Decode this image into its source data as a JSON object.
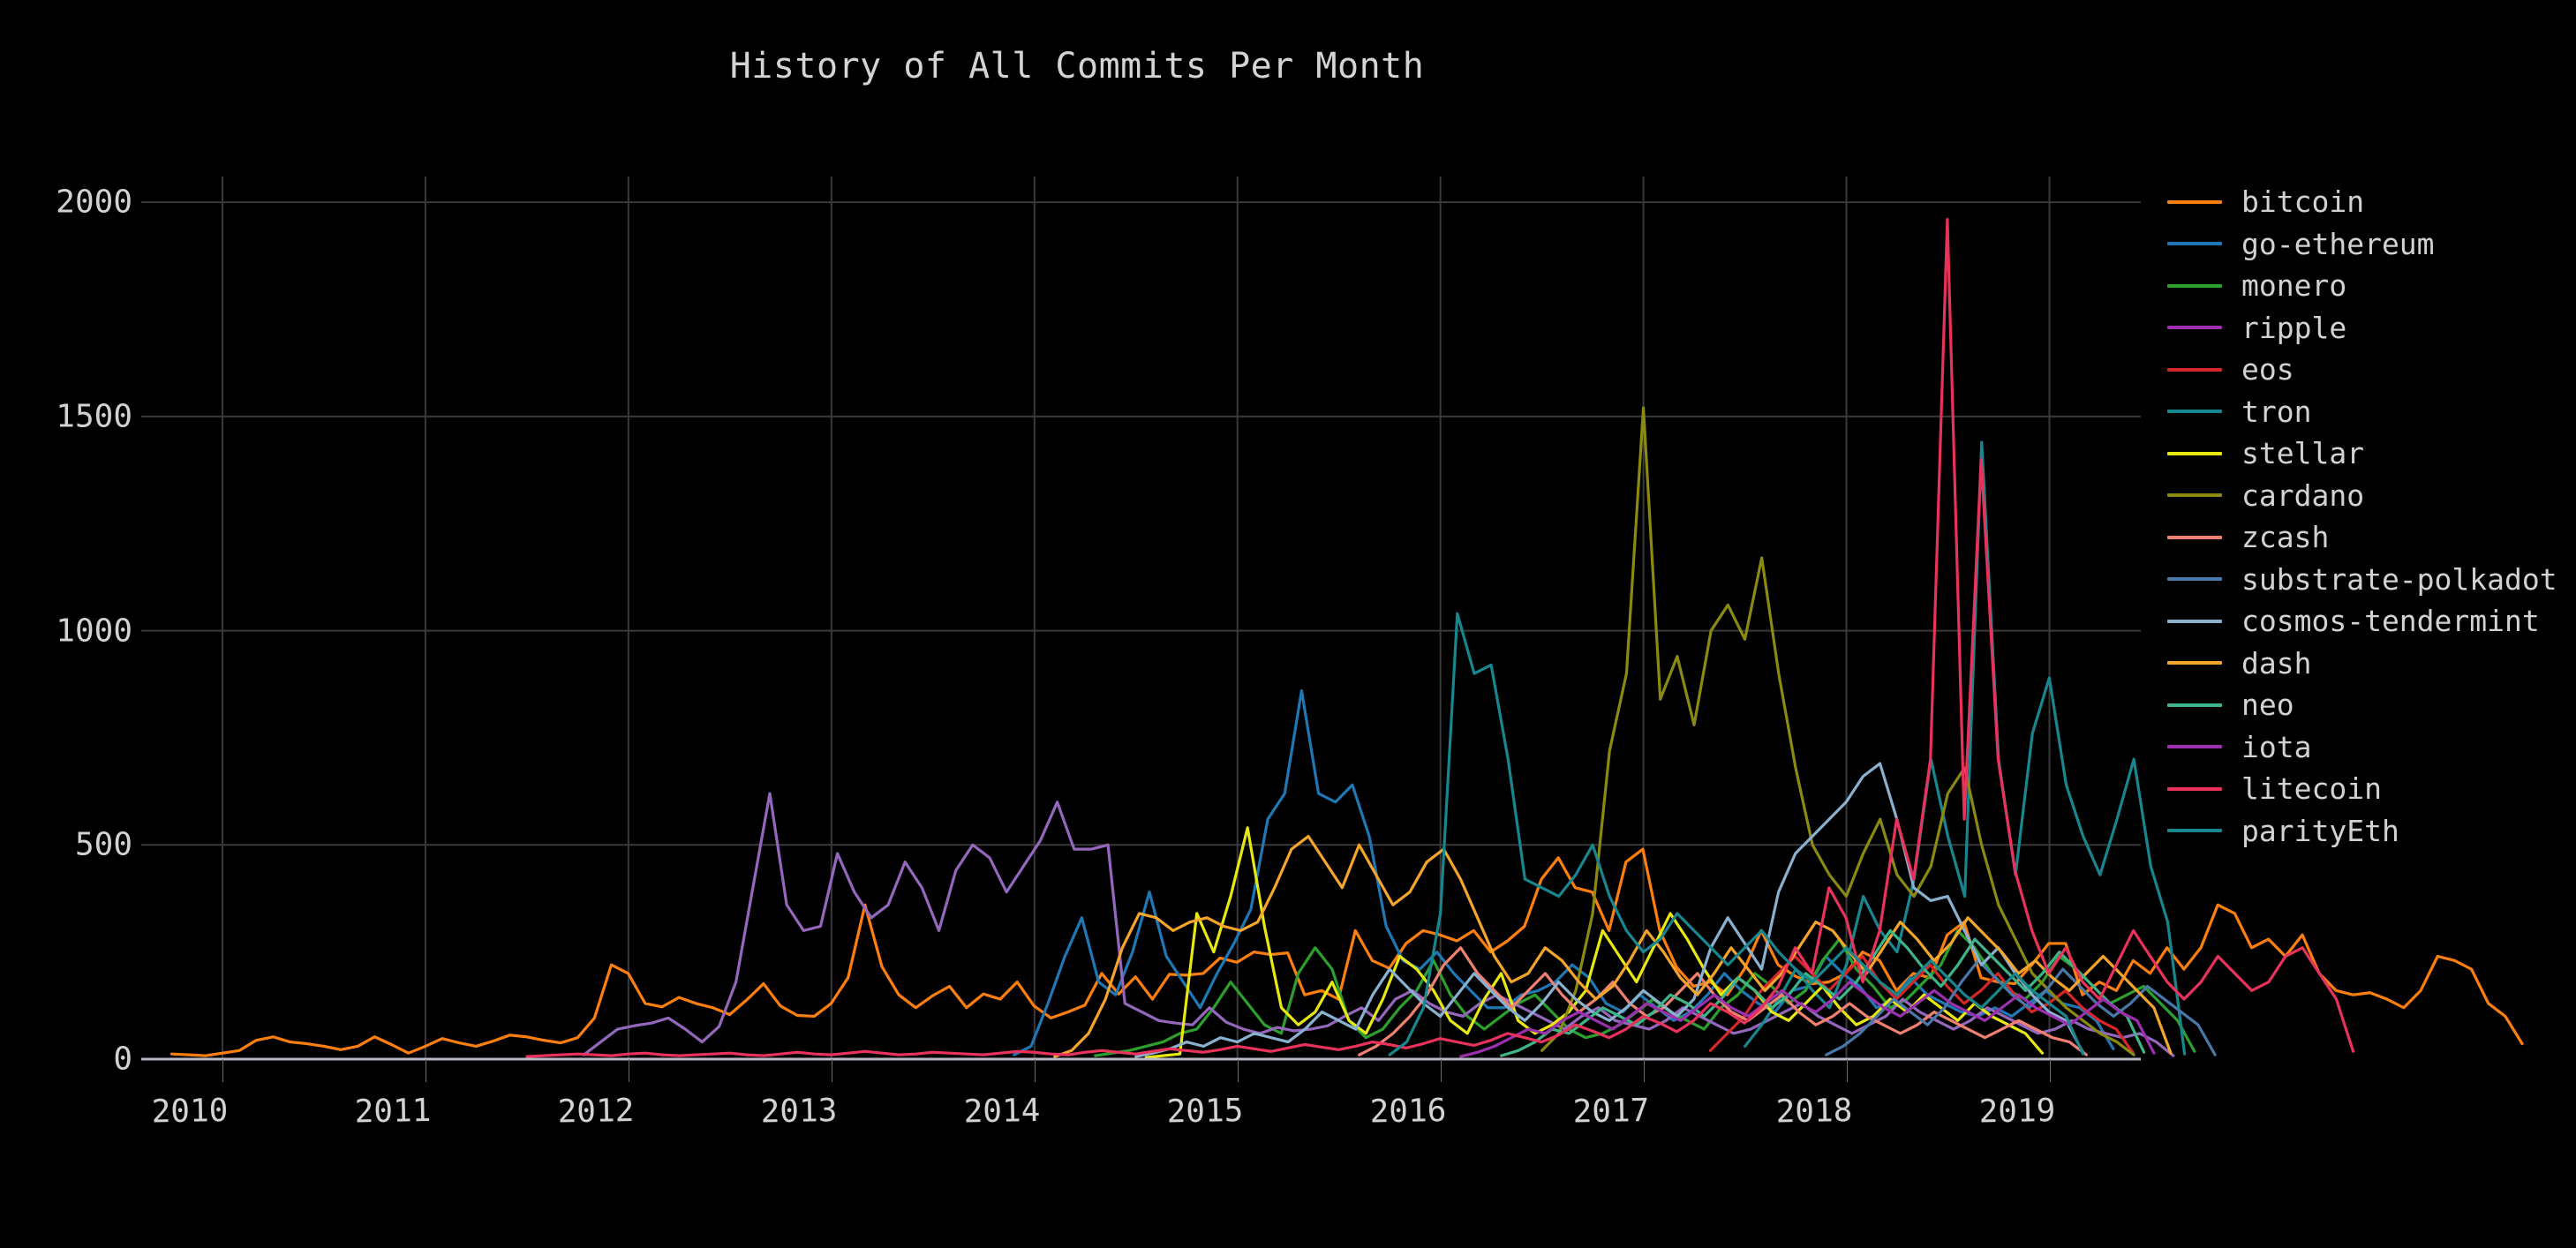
{
  "figure": {
    "title": "History of All Commits Per Month",
    "background_color": "#000000",
    "text_color": "#d2d2d2",
    "grid_color": "#3a3a3a",
    "baseline_color": "#b8b8c4"
  },
  "chart_data": {
    "type": "line",
    "title": "History of All Commits Per Month",
    "xlabel": "",
    "ylabel": "",
    "xlim": [
      2009.6,
      2019.45
    ],
    "ylim": [
      0,
      2060
    ],
    "xticks": [
      2010,
      2011,
      2012,
      2013,
      2014,
      2015,
      2016,
      2017,
      2018,
      2019
    ],
    "xtick_labels": [
      "2010",
      "2011",
      "2012",
      "2013",
      "2014",
      "2015",
      "2016",
      "2017",
      "2018",
      "2019"
    ],
    "yticks": [
      0,
      500,
      1000,
      1500,
      2000
    ],
    "ytick_labels": [
      "0",
      "500",
      "1000",
      "1500",
      "2000"
    ],
    "grid": true,
    "legend_position": "right",
    "x_step": 0.0833,
    "series": [
      {
        "name": "bitcoin",
        "color": "#ff7f0e",
        "x_start": 2009.75,
        "values": [
          12,
          10,
          8,
          14,
          20,
          44,
          52,
          40,
          36,
          30,
          22,
          30,
          52,
          34,
          14,
          30,
          48,
          38,
          30,
          42,
          56,
          52,
          44,
          38,
          50,
          96,
          220,
          200,
          130,
          122,
          144,
          130,
          120,
          104,
          138,
          176,
          124,
          102,
          100,
          130,
          190,
          360,
          216,
          150,
          120,
          148,
          170,
          120,
          152,
          140,
          180,
          124,
          96,
          110,
          126,
          200,
          152,
          192,
          140,
          198,
          196,
          200,
          236,
          226,
          250,
          244,
          248,
          150,
          160,
          140,
          300,
          230,
          212,
          270,
          300,
          290,
          276,
          300,
          250,
          276,
          310,
          420,
          470,
          400,
          390,
          300,
          460,
          490,
          300,
          214,
          170,
          180,
          150,
          210,
          300,
          220,
          194,
          176,
          180,
          200,
          250,
          230,
          160,
          200,
          190,
          290,
          320,
          190,
          180,
          176,
          220,
          270,
          270,
          150,
          180,
          160,
          230,
          200,
          260,
          210,
          260,
          360,
          340,
          260,
          280,
          240,
          290,
          200,
          160,
          150,
          155,
          140,
          120,
          160,
          240,
          230,
          210,
          130,
          100,
          36
        ]
      },
      {
        "name": "go-ethereum",
        "color": "#1f77b4",
        "x_start": 2013.9,
        "values": [
          10,
          30,
          130,
          240,
          330,
          180,
          150,
          250,
          390,
          240,
          180,
          120,
          200,
          270,
          350,
          560,
          620,
          860,
          620,
          600,
          640,
          520,
          310,
          230,
          210,
          250,
          200,
          160,
          120,
          120,
          150,
          160,
          180,
          220,
          190,
          130,
          110,
          150,
          120,
          90,
          110,
          150,
          200,
          160,
          130,
          110,
          160,
          170,
          240,
          200,
          170,
          120,
          140,
          190,
          150,
          130,
          110,
          100,
          120,
          100,
          130,
          160,
          130,
          120,
          90,
          24
        ]
      },
      {
        "name": "monero",
        "color": "#2ca02c",
        "x_start": 2014.3,
        "values": [
          8,
          14,
          20,
          30,
          40,
          60,
          70,
          120,
          180,
          130,
          80,
          60,
          200,
          260,
          210,
          90,
          50,
          70,
          120,
          160,
          230,
          150,
          100,
          70,
          100,
          130,
          150,
          110,
          70,
          50,
          60,
          80,
          110,
          140,
          110,
          90,
          70,
          120,
          150,
          200,
          170,
          130,
          160,
          230,
          280,
          210,
          170,
          120,
          140,
          180,
          220,
          300,
          260,
          200,
          160,
          140,
          180,
          240,
          210,
          170,
          130,
          150,
          170,
          130,
          90,
          18
        ]
      },
      {
        "name": "ripple",
        "color": "#9467bd",
        "x_start": 2011.78,
        "values": [
          10,
          40,
          70,
          78,
          84,
          96,
          70,
          40,
          76,
          180,
          400,
          620,
          360,
          300,
          310,
          480,
          390,
          330,
          360,
          460,
          400,
          300,
          440,
          500,
          470,
          390,
          450,
          510,
          600,
          490,
          490,
          500,
          130,
          110,
          90,
          84,
          80,
          120,
          86,
          70,
          60,
          74,
          66,
          70,
          78,
          100,
          120,
          90,
          140,
          160,
          130,
          110,
          100,
          130,
          150,
          130,
          110,
          90,
          70,
          100,
          120,
          90,
          80,
          70,
          90,
          120,
          100,
          80,
          60,
          70,
          90,
          110,
          130,
          100,
          80,
          60,
          80,
          100,
          140,
          110,
          90,
          70,
          90,
          120,
          100,
          80,
          60,
          70,
          90,
          70,
          60,
          50,
          60,
          40,
          8
        ]
      },
      {
        "name": "eos",
        "color": "#d62728",
        "x_start": 2017.33,
        "values": [
          20,
          60,
          100,
          160,
          200,
          240,
          200,
          160,
          200,
          240,
          180,
          140,
          180,
          220,
          170,
          130,
          160,
          200,
          150,
          110,
          130,
          160,
          120,
          90,
          70,
          14
        ]
      },
      {
        "name": "tron",
        "color": "#17868e",
        "x_start": 2017.5,
        "values": [
          30,
          80,
          140,
          210,
          160,
          120,
          220,
          380,
          300,
          250,
          420,
          700,
          520,
          380,
          1440,
          700,
          430,
          760,
          890,
          640,
          520,
          430,
          560,
          700,
          450,
          320,
          12
        ]
      },
      {
        "name": "stellar",
        "color": "#e8e811",
        "x_start": 2014.55,
        "values": [
          4,
          8,
          12,
          340,
          250,
          380,
          540,
          310,
          120,
          80,
          110,
          180,
          90,
          60,
          140,
          240,
          210,
          160,
          90,
          60,
          140,
          200,
          90,
          60,
          80,
          110,
          160,
          300,
          240,
          180,
          260,
          340,
          280,
          210,
          150,
          190,
          160,
          110,
          90,
          130,
          170,
          120,
          80,
          100,
          140,
          110,
          150,
          120,
          90,
          130,
          100,
          80,
          60,
          14
        ]
      },
      {
        "name": "cardano",
        "color": "#8a8a10",
        "x_start": 2016.5,
        "values": [
          20,
          60,
          160,
          340,
          720,
          900,
          1520,
          840,
          940,
          780,
          1000,
          1060,
          980,
          1170,
          900,
          680,
          500,
          430,
          380,
          480,
          560,
          430,
          380,
          450,
          620,
          680,
          500,
          360,
          280,
          200,
          160,
          120,
          90,
          60,
          40,
          10
        ]
      },
      {
        "name": "zcash",
        "color": "#f08070",
        "x_start": 2015.6,
        "values": [
          10,
          30,
          60,
          100,
          150,
          220,
          260,
          200,
          160,
          120,
          160,
          200,
          150,
          110,
          140,
          180,
          130,
          100,
          120,
          160,
          200,
          150,
          110,
          90,
          120,
          150,
          110,
          80,
          100,
          130,
          100,
          80,
          60,
          80,
          110,
          90,
          70,
          50,
          70,
          90,
          70,
          50,
          40,
          10
        ]
      },
      {
        "name": "substrate-polkadot",
        "color": "#4878a8",
        "x_start": 2017.9,
        "values": [
          10,
          30,
          60,
          100,
          140,
          110,
          80,
          120,
          180,
          230,
          190,
          150,
          120,
          160,
          210,
          170,
          130,
          100,
          130,
          170,
          140,
          110,
          80,
          10
        ]
      },
      {
        "name": "cosmos-tendermint",
        "color": "#8ab0cf",
        "x_start": 2014.5,
        "values": [
          6,
          14,
          24,
          40,
          30,
          50,
          40,
          60,
          50,
          40,
          70,
          110,
          90,
          70,
          150,
          210,
          170,
          130,
          100,
          150,
          200,
          160,
          120,
          90,
          130,
          180,
          140,
          110,
          90,
          120,
          160,
          130,
          100,
          140,
          260,
          330,
          270,
          210,
          390,
          480,
          520,
          560,
          600,
          660,
          690,
          560,
          400,
          370,
          380,
          300,
          220,
          260,
          200,
          150,
          110,
          90,
          16
        ]
      },
      {
        "name": "dash",
        "color": "#f5a52a",
        "x_start": 2014.1,
        "values": [
          6,
          20,
          60,
          140,
          260,
          340,
          330,
          300,
          320,
          330,
          310,
          300,
          320,
          400,
          490,
          520,
          460,
          400,
          500,
          430,
          360,
          390,
          460,
          490,
          420,
          330,
          240,
          180,
          200,
          260,
          230,
          180,
          140,
          170,
          230,
          300,
          250,
          190,
          150,
          200,
          260,
          210,
          160,
          200,
          260,
          320,
          300,
          250,
          200,
          260,
          320,
          280,
          230,
          270,
          330,
          290,
          250,
          200,
          230,
          190,
          160,
          200,
          240,
          200,
          160,
          120,
          14
        ]
      },
      {
        "name": "neo",
        "color": "#3eb489",
        "x_start": 2016.3,
        "values": [
          8,
          20,
          40,
          70,
          60,
          90,
          120,
          100,
          80,
          110,
          150,
          130,
          100,
          140,
          190,
          160,
          120,
          150,
          200,
          170,
          140,
          180,
          240,
          300,
          260,
          210,
          170,
          220,
          280,
          240,
          200,
          160,
          200,
          250,
          210,
          170,
          130,
          100,
          16
        ]
      },
      {
        "name": "iota",
        "color": "#9b2fae",
        "x_start": 2016.1,
        "values": [
          6,
          16,
          30,
          50,
          70,
          60,
          90,
          110,
          90,
          70,
          100,
          130,
          110,
          90,
          120,
          150,
          120,
          100,
          130,
          160,
          130,
          110,
          140,
          180,
          150,
          120,
          100,
          130,
          160,
          130,
          110,
          90,
          120,
          150,
          120,
          100,
          80,
          110,
          140,
          110,
          90,
          14
        ]
      },
      {
        "name": "litecoin",
        "color": "#e8325c",
        "x_start": 2011.5,
        "values": [
          6,
          8,
          10,
          12,
          10,
          8,
          12,
          14,
          10,
          8,
          10,
          12,
          14,
          10,
          8,
          12,
          16,
          12,
          10,
          14,
          18,
          14,
          10,
          12,
          16,
          14,
          12,
          10,
          14,
          18,
          16,
          12,
          10,
          16,
          20,
          16,
          12,
          18,
          24,
          20,
          16,
          22,
          30,
          24,
          18,
          26,
          34,
          28,
          22,
          30,
          40,
          34,
          26,
          36,
          48,
          40,
          32,
          44,
          60,
          50,
          40,
          56,
          80,
          66,
          50,
          70,
          100,
          84,
          64,
          90,
          130,
          110,
          84,
          120,
          170,
          260,
          200,
          400,
          330,
          180,
          300,
          560,
          420,
          700,
          1960,
          560,
          1400,
          700,
          440,
          300,
          200,
          260,
          180,
          140,
          220,
          300,
          240,
          180,
          140,
          180,
          240,
          200,
          160,
          180,
          240,
          260,
          200,
          140,
          18
        ]
      },
      {
        "name": "parityEth",
        "color": "#17868e",
        "x_start": 2015.75,
        "values": [
          10,
          40,
          120,
          340,
          1040,
          900,
          920,
          700,
          420,
          400,
          380,
          430,
          500,
          380,
          300,
          250,
          280,
          340,
          300,
          260,
          220,
          260,
          300,
          250,
          210,
          180,
          220,
          260,
          220,
          180,
          150,
          190,
          230,
          190,
          150,
          120,
          160,
          200,
          160,
          130,
          100,
          12
        ]
      }
    ]
  },
  "legend": {
    "items": [
      {
        "label": "bitcoin",
        "color": "#ff7f0e"
      },
      {
        "label": "go-ethereum",
        "color": "#1f77b4"
      },
      {
        "label": "monero",
        "color": "#2ca02c"
      },
      {
        "label": "ripple",
        "color": "#9b2fae"
      },
      {
        "label": "eos",
        "color": "#d62728"
      },
      {
        "label": "tron",
        "color": "#17868e"
      },
      {
        "label": "stellar",
        "color": "#e8e811"
      },
      {
        "label": "cardano",
        "color": "#8a8a10"
      },
      {
        "label": "zcash",
        "color": "#f08070"
      },
      {
        "label": "substrate-polkadot",
        "color": "#4878a8"
      },
      {
        "label": "cosmos-tendermint",
        "color": "#8ab0cf"
      },
      {
        "label": "dash",
        "color": "#f5a52a"
      },
      {
        "label": "neo",
        "color": "#3eb489"
      },
      {
        "label": "iota",
        "color": "#9b2fae"
      },
      {
        "label": "litecoin",
        "color": "#e8325c"
      },
      {
        "label": "parityEth",
        "color": "#17868e"
      }
    ]
  }
}
